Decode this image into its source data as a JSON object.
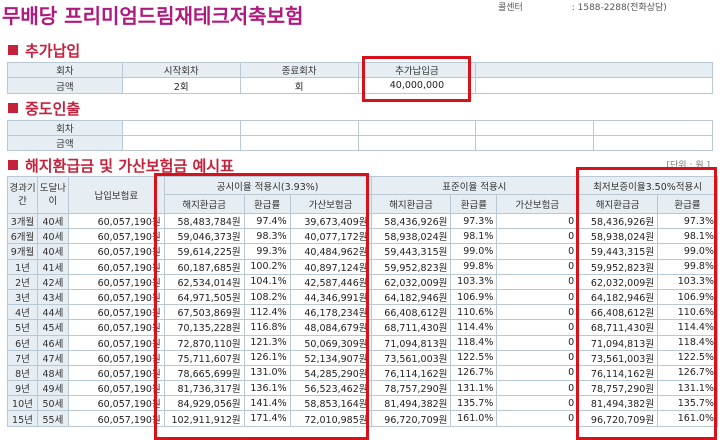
{
  "header": {
    "title": "무배당 프리미엄드림재테크저축보험",
    "contact_label": "콜센터",
    "contact_value": ": 1588-2288(전화상담)"
  },
  "section_additional": {
    "title": "추가납입",
    "columns": [
      "회차",
      "시작회차",
      "종료회차",
      "추가납입금"
    ],
    "row_label": "금액",
    "row_values": [
      "2회",
      "회",
      "40,000,000"
    ]
  },
  "section_withdrawal": {
    "title": "중도인출",
    "row_labels": [
      "회차",
      "금액"
    ]
  },
  "section_refund": {
    "title": "해지환급금 및 가산보험금 예시표",
    "unit_note": "[단위 : 원 ]",
    "col_elapsed": "경과기간",
    "col_age": "도달나이",
    "col_premium": "납입보험료",
    "group1": "공시이율 적용시(3.93%)",
    "group2": "표준이율 적용시",
    "group3": "최저보증이율3.50%적용시",
    "sub_refund": "해지환급금",
    "sub_rate": "환급률",
    "sub_bonus": "가산보험금",
    "rows": [
      {
        "period": "3개월",
        "age": "40세",
        "premium": "60,057,190원",
        "a_refund": "58,483,784원",
        "a_rate": "97.4%",
        "a_bonus": "39,673,409원",
        "b_refund": "58,436,926원",
        "b_rate": "97.3%",
        "b_bonus": "0",
        "c_refund": "58,436,926원",
        "c_rate": "97.3%"
      },
      {
        "period": "6개월",
        "age": "40세",
        "premium": "60,057,190원",
        "a_refund": "59,046,373원",
        "a_rate": "98.3%",
        "a_bonus": "40,077,172원",
        "b_refund": "58,938,024원",
        "b_rate": "98.1%",
        "b_bonus": "0",
        "c_refund": "58,938,024원",
        "c_rate": "98.1%"
      },
      {
        "period": "9개월",
        "age": "40세",
        "premium": "60,057,190원",
        "a_refund": "59,614,225원",
        "a_rate": "99.3%",
        "a_bonus": "40,484,962원",
        "b_refund": "59,443,315원",
        "b_rate": "99.0%",
        "b_bonus": "0",
        "c_refund": "59,443,315원",
        "c_rate": "99.0%"
      },
      {
        "period": "1년",
        "age": "41세",
        "premium": "60,057,190원",
        "a_refund": "60,187,685원",
        "a_rate": "100.2%",
        "a_bonus": "40,897,124원",
        "b_refund": "59,952,823원",
        "b_rate": "99.8%",
        "b_bonus": "0",
        "c_refund": "59,952,823원",
        "c_rate": "99.8%"
      },
      {
        "period": "2년",
        "age": "42세",
        "premium": "60,057,190원",
        "a_refund": "62,534,014원",
        "a_rate": "104.1%",
        "a_bonus": "42,587,446원",
        "b_refund": "62,032,009원",
        "b_rate": "103.3%",
        "b_bonus": "0",
        "c_refund": "62,032,009원",
        "c_rate": "103.3%"
      },
      {
        "period": "3년",
        "age": "43세",
        "premium": "60,057,190원",
        "a_refund": "64,971,505원",
        "a_rate": "108.2%",
        "a_bonus": "44,346,991원",
        "b_refund": "64,182,946원",
        "b_rate": "106.9%",
        "b_bonus": "0",
        "c_refund": "64,182,946원",
        "c_rate": "106.9%"
      },
      {
        "period": "4년",
        "age": "44세",
        "premium": "60,057,190원",
        "a_refund": "67,503,869원",
        "a_rate": "112.4%",
        "a_bonus": "46,178,234원",
        "b_refund": "66,408,612원",
        "b_rate": "110.6%",
        "b_bonus": "0",
        "c_refund": "66,408,612원",
        "c_rate": "110.6%"
      },
      {
        "period": "5년",
        "age": "45세",
        "premium": "60,057,190원",
        "a_refund": "70,135,228원",
        "a_rate": "116.8%",
        "a_bonus": "48,084,679원",
        "b_refund": "68,711,430원",
        "b_rate": "114.4%",
        "b_bonus": "0",
        "c_refund": "68,711,430원",
        "c_rate": "114.4%"
      },
      {
        "period": "6년",
        "age": "46세",
        "premium": "60,057,190원",
        "a_refund": "72,870,110원",
        "a_rate": "121.3%",
        "a_bonus": "50,069,309원",
        "b_refund": "71,094,813원",
        "b_rate": "118.4%",
        "b_bonus": "0",
        "c_refund": "71,094,813원",
        "c_rate": "118.4%"
      },
      {
        "period": "7년",
        "age": "47세",
        "premium": "60,057,190원",
        "a_refund": "75,711,607원",
        "a_rate": "126.1%",
        "a_bonus": "52,134,907원",
        "b_refund": "73,561,003원",
        "b_rate": "122.5%",
        "b_bonus": "0",
        "c_refund": "73,561,003원",
        "c_rate": "122.5%"
      },
      {
        "period": "8년",
        "age": "48세",
        "premium": "60,057,190원",
        "a_refund": "78,665,699원",
        "a_rate": "131.0%",
        "a_bonus": "54,285,290원",
        "b_refund": "76,114,162원",
        "b_rate": "126.7%",
        "b_bonus": "0",
        "c_refund": "76,114,162원",
        "c_rate": "126.7%"
      },
      {
        "period": "9년",
        "age": "49세",
        "premium": "60,057,190원",
        "a_refund": "81,736,317원",
        "a_rate": "136.1%",
        "a_bonus": "56,523,462원",
        "b_refund": "78,757,290원",
        "b_rate": "131.1%",
        "b_bonus": "0",
        "c_refund": "78,757,290원",
        "c_rate": "131.1%"
      },
      {
        "period": "10년",
        "age": "50세",
        "premium": "60,057,190원",
        "a_refund": "84,929,056원",
        "a_rate": "141.4%",
        "a_bonus": "58,853,164원",
        "b_refund": "81,494,382원",
        "b_rate": "135.7%",
        "b_bonus": "0",
        "c_refund": "81,494,382원",
        "c_rate": "135.7%"
      },
      {
        "period": "15년",
        "age": "55세",
        "premium": "60,057,190원",
        "a_refund": "102,911,912원",
        "a_rate": "171.4%",
        "a_bonus": "72,010,985원",
        "b_refund": "96,720,709원",
        "b_rate": "161.0%",
        "b_bonus": "0",
        "c_refund": "96,720,709원",
        "c_rate": "161.0%"
      }
    ]
  },
  "colors": {
    "title": "#b0197e",
    "section": "#c6213b",
    "highlight": "#d8121b",
    "header_bg": "#e6eef3"
  }
}
